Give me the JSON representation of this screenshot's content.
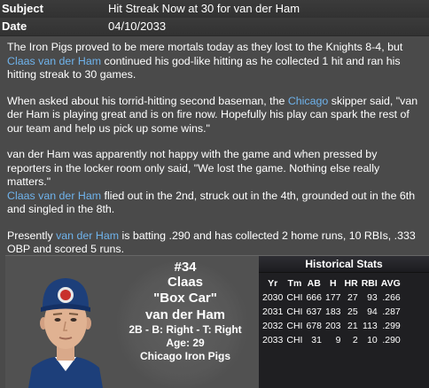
{
  "header": {
    "subject_label": "Subject",
    "subject_value": "Hit Streak Now at 30 for van der Ham",
    "date_label": "Date",
    "date_value": "04/10/2033"
  },
  "article": {
    "p1": {
      "t1": "The Iron Pigs proved to be mere mortals today as they lost to the Knights 8-4, but ",
      "link": "Claas van der Ham",
      "t2": " continued his god-like hitting as he collected 1 hit and ran his hitting streak to 30 games."
    },
    "p2": {
      "t1": "When asked about his torrid-hitting second baseman, the ",
      "link": "Chicago",
      "t2": " skipper said, \"van der Ham is playing great and is on fire now. Hopefully his play can spark the rest of our team and help us pick up some wins.\""
    },
    "p3": {
      "t1": "van der Ham was apparently not happy with the game and when pressed by reporters in the locker room only said, \"We lost the game. Nothing else really matters.\"",
      "link": "Claas van der Ham",
      "t2": " flied out in the 2nd, struck out in the 4th, grounded out in the 6th and singled in the 8th."
    },
    "p4": {
      "t1": "Presently ",
      "link": "van der Ham",
      "t2": " is batting .290 and has collected 2 home runs, 10 RBIs, .333 OBP and scored 5 runs."
    }
  },
  "player": {
    "number": "#34",
    "first_name": "Claas",
    "nickname": "\"Box Car\"",
    "last_name": "van der Ham",
    "position_line": "2B - B: Right - T: Right",
    "age_line": "Age: 29",
    "team": "Chicago Iron Pigs",
    "cap_color": "#1d3f7a",
    "jersey_color": "#1d3f7a"
  },
  "stats": {
    "title": "Historical Stats",
    "columns": [
      "Yr",
      "Tm",
      "AB",
      "H",
      "HR",
      "RBI",
      "AVG"
    ],
    "rows": [
      [
        "2030",
        "CHI",
        "666",
        "177",
        "27",
        "93",
        ".266"
      ],
      [
        "2031",
        "CHI",
        "637",
        "183",
        "25",
        "94",
        ".287"
      ],
      [
        "2032",
        "CHI",
        "678",
        "203",
        "21",
        "113",
        ".299"
      ],
      [
        "2033",
        "CHI",
        "31",
        "9",
        "2",
        "10",
        ".290"
      ]
    ]
  }
}
